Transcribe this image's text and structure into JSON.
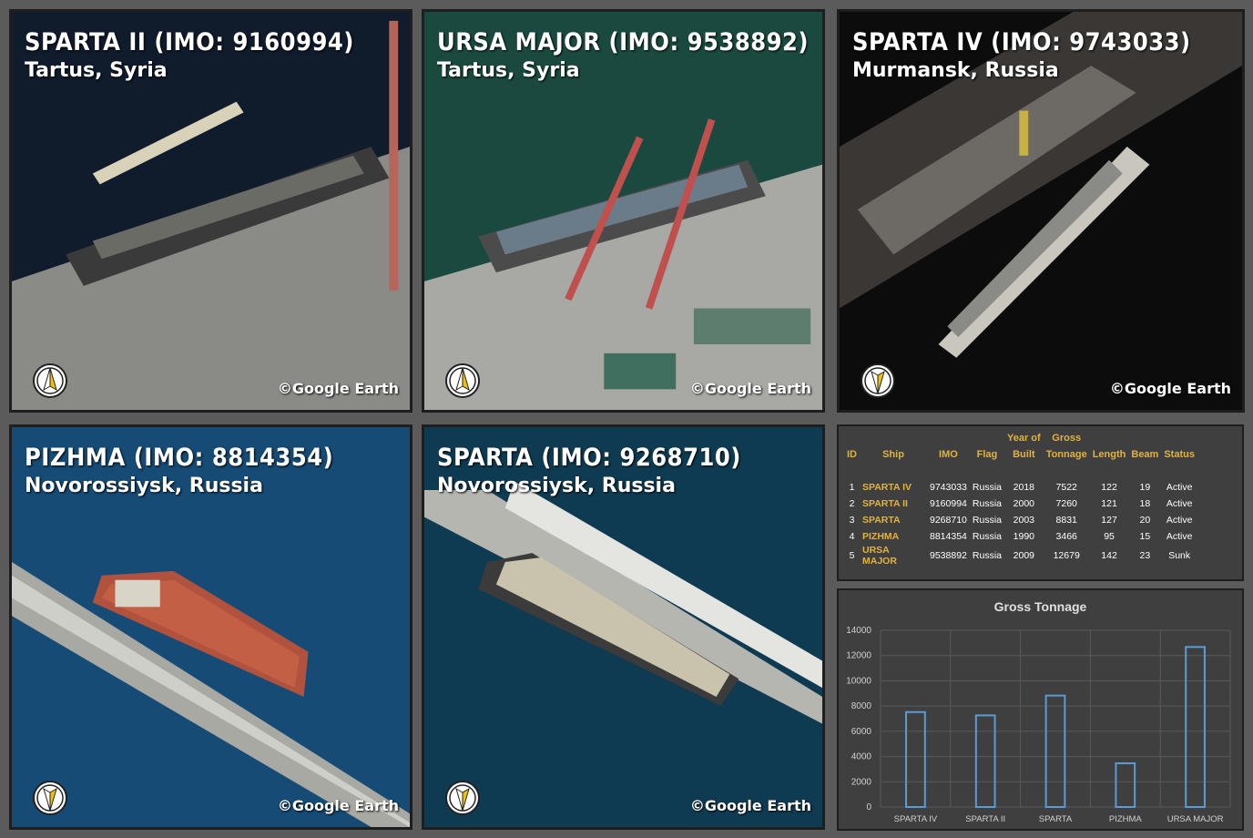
{
  "panels": [
    {
      "title": "SPARTA II (IMO: 9160994)",
      "location": "Tartus, Syria",
      "credit": "©Google Earth",
      "compass": "north-up-compass-icon"
    },
    {
      "title": "URSA MAJOR (IMO: 9538892)",
      "location": "Tartus, Syria",
      "credit": "©Google Earth",
      "compass": "north-up-compass-icon"
    },
    {
      "title": "SPARTA IV (IMO: 9743033)",
      "location": "Murmansk, Russia",
      "credit": "©Google Earth",
      "compass": "north-down-compass-icon"
    },
    {
      "title": "PIZHMA (IMO: 8814354)",
      "location": "Novorossiysk, Russia",
      "credit": "©Google Earth",
      "compass": "north-down-compass-icon"
    },
    {
      "title": "SPARTA (IMO: 9268710)",
      "location": "Novorossiysk, Russia",
      "credit": "©Google Earth",
      "compass": "north-down-compass-icon"
    }
  ],
  "table": {
    "headers": {
      "id": "ID",
      "ship": "Ship",
      "imo": "IMO",
      "flag": "Flag",
      "year_top": "Year of",
      "year_bottom": "Built",
      "tonnage_top": "Gross",
      "tonnage_bottom": "Tonnage",
      "length": "Length",
      "beam": "Beam",
      "status": "Status"
    },
    "rows": [
      {
        "id": "1",
        "ship": "SPARTA IV",
        "imo": "9743033",
        "flag": "Russia",
        "year": "2018",
        "tonnage": "7522",
        "length": "122",
        "beam": "19",
        "status": "Active"
      },
      {
        "id": "2",
        "ship": "SPARTA II",
        "imo": "9160994",
        "flag": "Russia",
        "year": "2000",
        "tonnage": "7260",
        "length": "121",
        "beam": "18",
        "status": "Active"
      },
      {
        "id": "3",
        "ship": "SPARTA",
        "imo": "9268710",
        "flag": "Russia",
        "year": "2003",
        "tonnage": "8831",
        "length": "127",
        "beam": "20",
        "status": "Active"
      },
      {
        "id": "4",
        "ship": "PIZHMA",
        "imo": "8814354",
        "flag": "Russia",
        "year": "1990",
        "tonnage": "3466",
        "length": "95",
        "beam": "15",
        "status": "Active"
      },
      {
        "id": "5",
        "ship": "URSA MAJOR",
        "imo": "9538892",
        "flag": "Russia",
        "year": "2009",
        "tonnage": "12679",
        "length": "142",
        "beam": "23",
        "status": "Sunk"
      }
    ]
  },
  "chart_data": {
    "type": "bar",
    "title": "Gross Tonnage",
    "categories": [
      "SPARTA IV",
      "SPARTA II",
      "SPARTA",
      "PIZHMA",
      "URSA MAJOR"
    ],
    "values": [
      7522,
      7260,
      8831,
      3466,
      12679
    ],
    "ylim": [
      0,
      14000
    ],
    "yticks": [
      0,
      2000,
      4000,
      6000,
      8000,
      10000,
      12000,
      14000
    ],
    "grid": true,
    "bar_color": "#5b9bd5"
  }
}
